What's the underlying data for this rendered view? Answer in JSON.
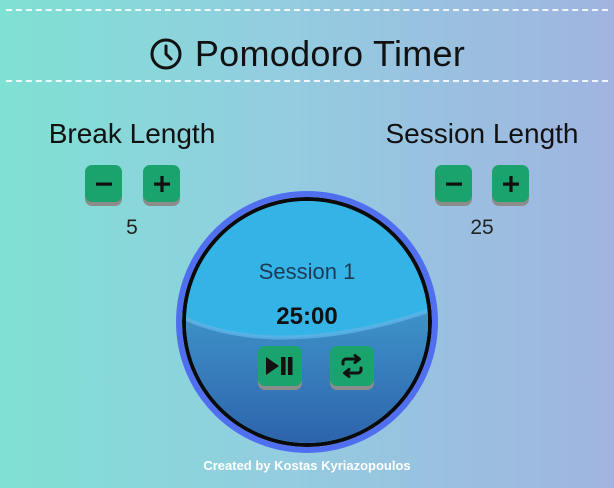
{
  "header": {
    "icon": "clock-icon",
    "title": "Pomodoro Timer"
  },
  "break": {
    "label": "Break Length",
    "value": "5",
    "decrement_icon": "minus-icon",
    "increment_icon": "plus-icon"
  },
  "session": {
    "label": "Session Length",
    "value": "25",
    "decrement_icon": "minus-icon",
    "increment_icon": "plus-icon"
  },
  "timer": {
    "session_name": "Session 1",
    "time_left": "25:00",
    "play_pause_icon": "play-pause-icon",
    "reset_icon": "repeat-icon"
  },
  "footer": {
    "credit": "Created by Kostas Kyriazopoulos"
  },
  "colors": {
    "background_start": "#7fe1d3",
    "background_end": "#a0b4e0",
    "button_green": "#1aa36c",
    "ring_blue": "#4f6ff0",
    "water_top": "#34b4e6",
    "water_bottom": "#2f6db4"
  }
}
